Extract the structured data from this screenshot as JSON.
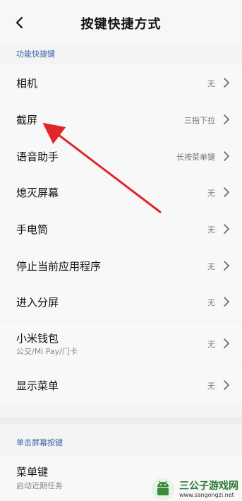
{
  "header": {
    "title": "按键快捷方式",
    "back_icon": "chevron-left-icon"
  },
  "sections": [
    {
      "label": "功能快捷键",
      "items": [
        {
          "label": "相机",
          "value": "无"
        },
        {
          "label": "截屏",
          "value": "三指下拉"
        },
        {
          "label": "语音助手",
          "value": "长按菜单键"
        },
        {
          "label": "熄灭屏幕",
          "value": "无"
        },
        {
          "label": "手电筒",
          "value": "无"
        },
        {
          "label": "停止当前应用程序",
          "value": "无"
        },
        {
          "label": "进入分屏",
          "value": "无"
        },
        {
          "label": "小米钱包",
          "sub": "公交/Mi Pay/门卡",
          "value": "无"
        },
        {
          "label": "显示菜单",
          "value": "无"
        }
      ]
    },
    {
      "label": "单击屏幕按键",
      "items": [
        {
          "label": "菜单键",
          "sub": "启动近期任务"
        }
      ]
    }
  ],
  "annotation": {
    "arrow_color": "#e0262a"
  },
  "watermark": {
    "title": "三公子游戏网",
    "url": "www.sangongzi.net"
  }
}
